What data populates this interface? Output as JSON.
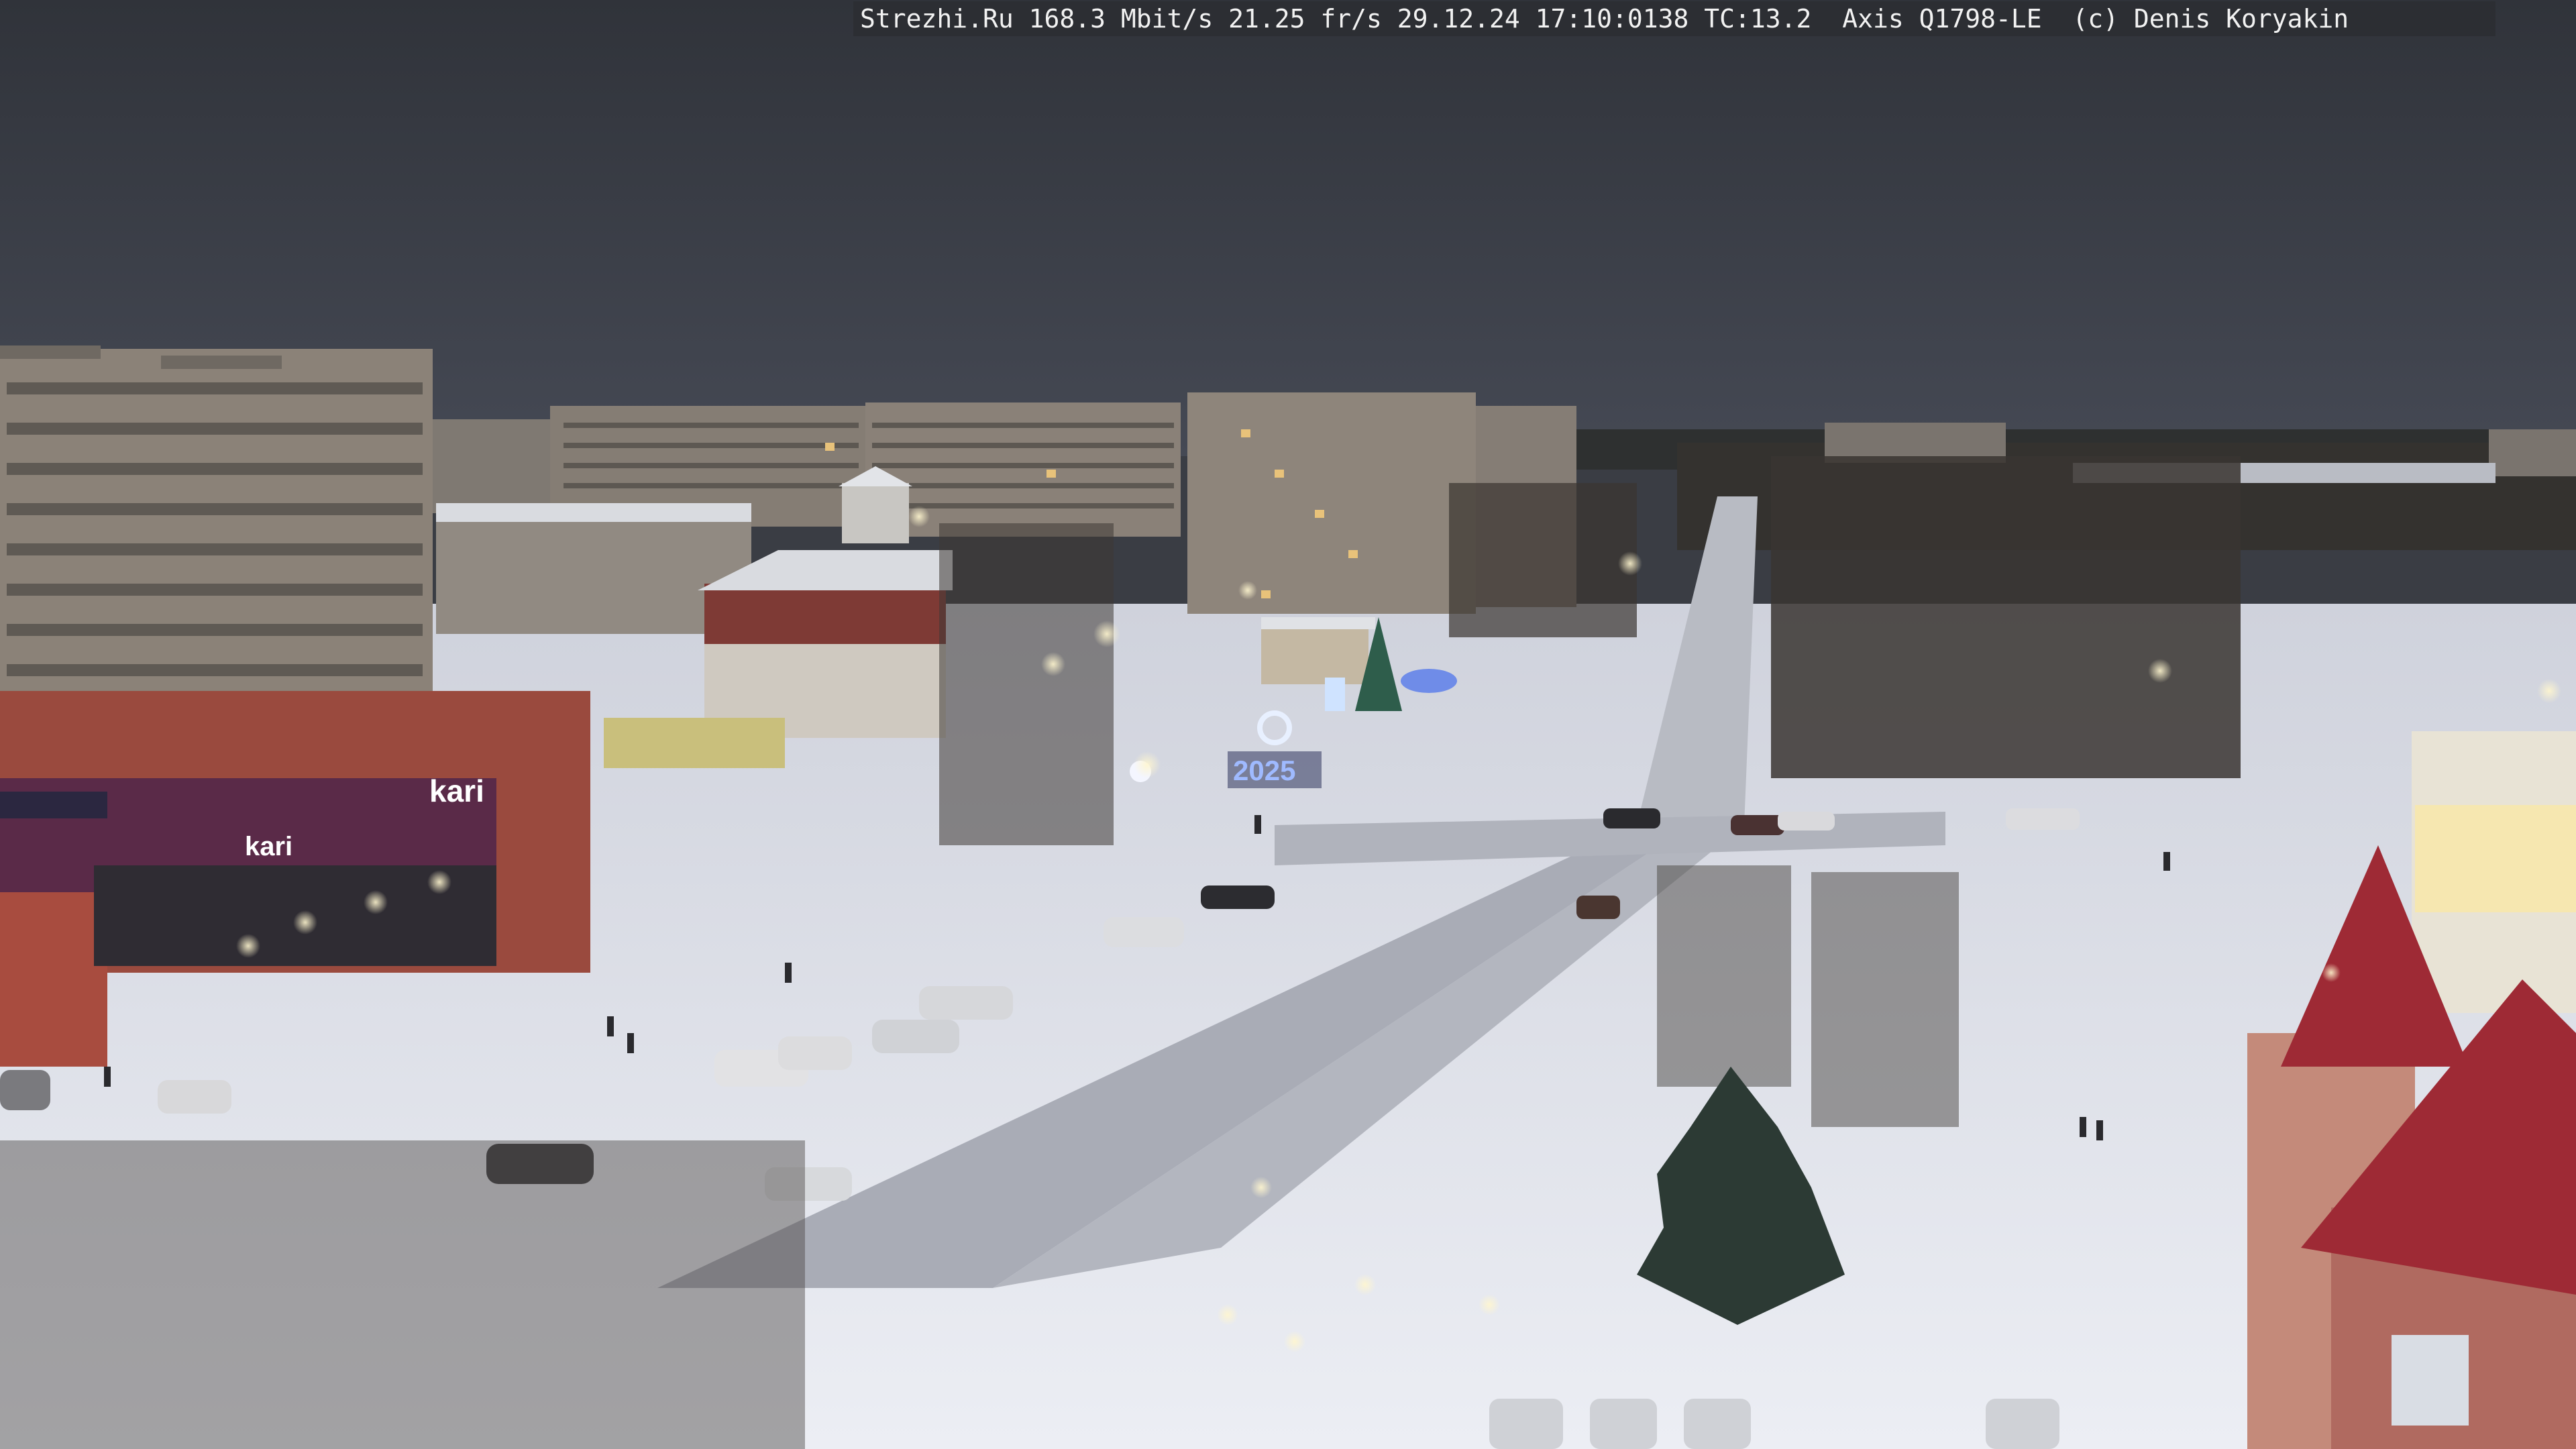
{
  "overlay": {
    "text": "Strezhi.Ru 168.3 Mbit/s 21.25 fr/s 29.12.24 17:10:0138 TC:13.2  Axis Q1798-LE  (c) Denis Koryakin"
  },
  "signs": {
    "kari_main": "kari",
    "kari_awning": "kari",
    "year_sculpture": "2025"
  },
  "colors": {
    "sky": "#3b3f47",
    "snow": "#e6e8ef",
    "road": "#a9acb6",
    "panel_building": "#8b8278",
    "shop_brick": "#9a4a3e",
    "shop_sign": "#5a2a48",
    "trees": "#3a3531",
    "streetlight": "#fff1b8",
    "decor_blue": "#7aa8ff"
  }
}
